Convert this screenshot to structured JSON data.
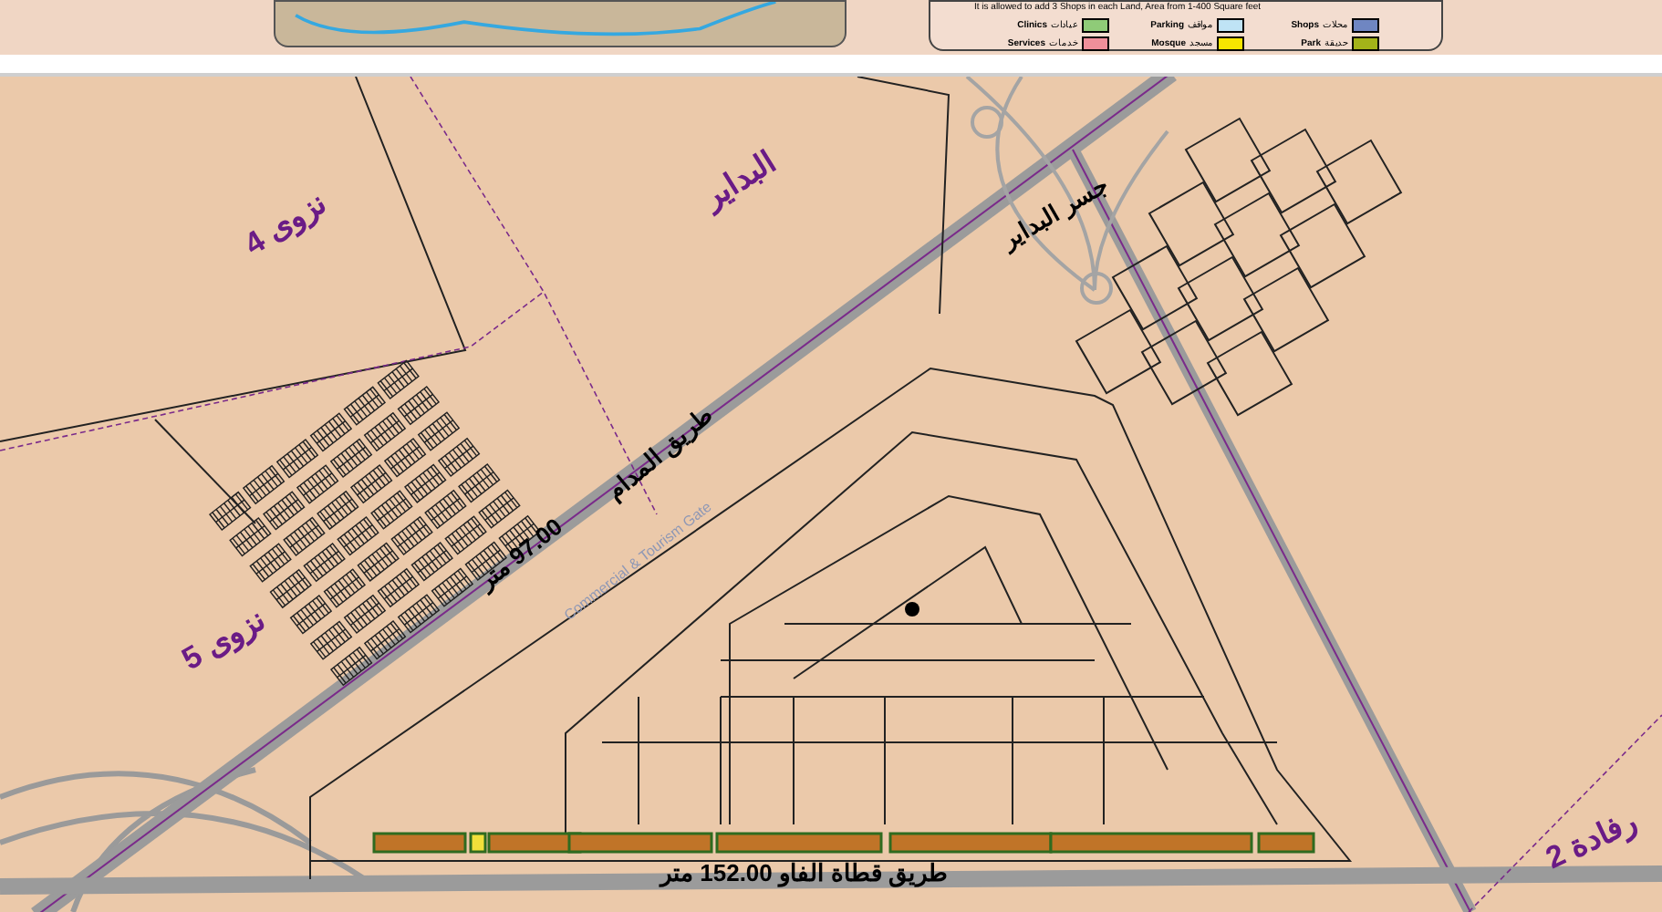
{
  "legend": {
    "note": "It is allowed to add 3 Shops in each Land, Area from 1-400 Square feet",
    "rows": [
      {
        "items": [
          {
            "label_en": "Shops",
            "label_ar": "محلات",
            "color": "#6f86c2"
          },
          {
            "label_en": "Parking",
            "label_ar": "مواقف",
            "color": "#bfe3f5"
          },
          {
            "label_en": "Clinics",
            "label_ar": "عيادات",
            "color": "#8fcb78"
          }
        ]
      },
      {
        "items": [
          {
            "label_en": "Park",
            "label_ar": "حديقة",
            "color": "#a3b319"
          },
          {
            "label_en": "Mosque",
            "label_ar": "مسجد",
            "color": "#f7e600"
          },
          {
            "label_en": "Services",
            "label_ar": "خدمات",
            "color": "#ef8f9a"
          }
        ]
      }
    ]
  },
  "map_labels": [
    {
      "kind": "area",
      "text": "نزوى 4"
    },
    {
      "kind": "area",
      "text": "البداير"
    },
    {
      "kind": "road",
      "text": "جسر البداير"
    },
    {
      "kind": "road",
      "text": "طريق المدام"
    },
    {
      "kind": "road",
      "text": "97.00 متر"
    },
    {
      "kind": "gate",
      "text": "Commercial & Tourism Gate"
    },
    {
      "kind": "area",
      "text": "نزوى 5"
    },
    {
      "kind": "road",
      "text": "طريق قطاة الفاو 152.00 متر"
    },
    {
      "kind": "area",
      "text": "رفادة 2"
    }
  ]
}
